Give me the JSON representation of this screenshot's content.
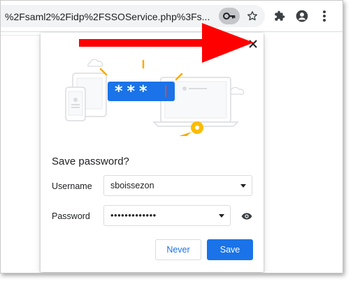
{
  "toolbar": {
    "url_text": "%2Fsaml2%2Fidp%2FSSOService.php%3Fs...",
    "icons": [
      "key-icon",
      "star-icon",
      "extensions-icon",
      "profile-icon",
      "menu-icon"
    ]
  },
  "dialog": {
    "title": "Save password?",
    "illustration_dots": "***",
    "username": {
      "label": "Username",
      "value": "sboissezon"
    },
    "password": {
      "label": "Password",
      "value": "•••••••••••••"
    },
    "buttons": {
      "never": "Never",
      "save": "Save"
    }
  },
  "colors": {
    "accent": "#1a73e8",
    "arrow": "#ff0000",
    "key": "#f9ab00"
  }
}
